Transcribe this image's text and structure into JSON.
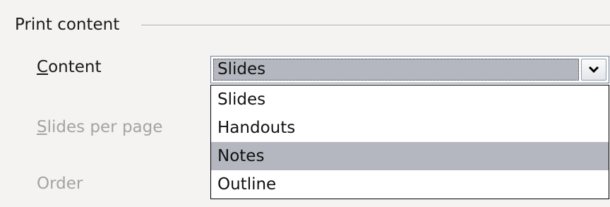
{
  "group": {
    "title": "Print content"
  },
  "fields": {
    "content": {
      "label_mnemonic": "C",
      "label_rest": "ontent"
    },
    "slides_per_page": {
      "label_mnemonic": "S",
      "label_rest": "lides per page",
      "disabled": true
    },
    "order": {
      "label": "Order",
      "disabled": true
    }
  },
  "combo": {
    "value": "Slides",
    "button_icon": "chevron-down-icon",
    "options": [
      "Slides",
      "Handouts",
      "Notes",
      "Outline"
    ],
    "highlighted_option": "Notes"
  },
  "colors": {
    "selection": "#b4b7bf",
    "disabled_text": "#a3a3a3"
  }
}
